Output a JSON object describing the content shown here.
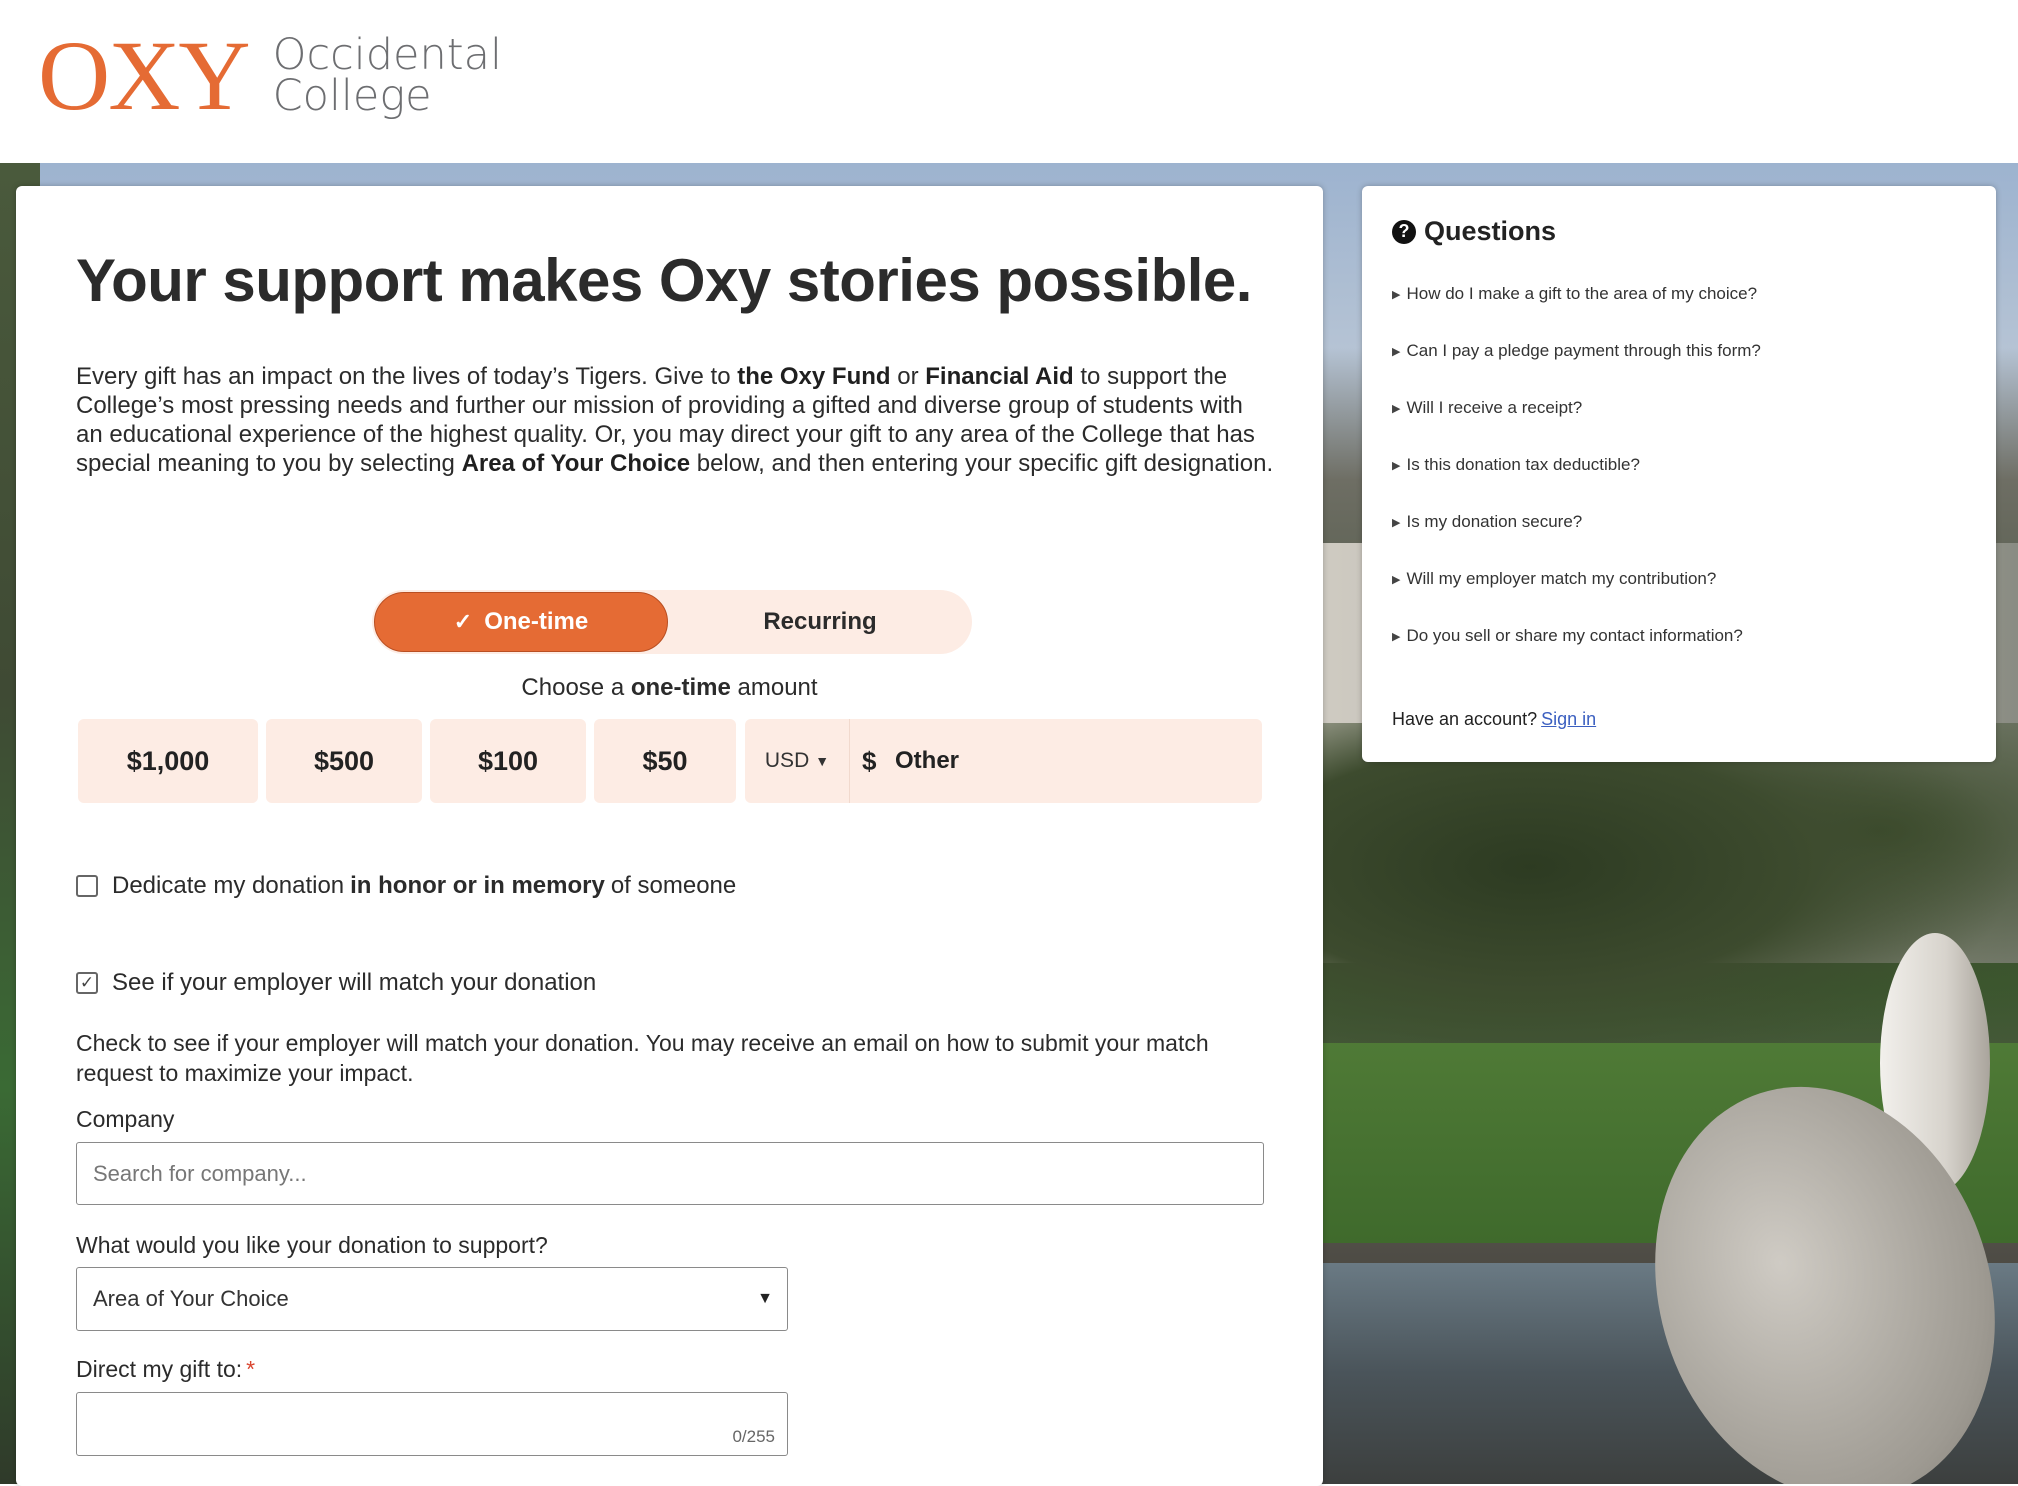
{
  "brand": {
    "mark": "OXY",
    "name_line1": "Occidental",
    "name_line2": "College",
    "accent_color": "#e56b34"
  },
  "main": {
    "headline": "Your support makes Oxy stories possible.",
    "intro": {
      "p1": "Every gift has an impact on the lives of today’s Tigers. Give to ",
      "b1": "the Oxy Fund",
      "p2": " or ",
      "b2": "Financial Aid",
      "p3": " to support the College’s most pressing needs and further our mission of providing a gifted and diverse group of students with an educational experience of the highest quality. Or, you may direct your gift to any area of the College that has special meaning to you by selecting ",
      "b3": "Area of Your Choice",
      "p4": " below, and then entering your specific gift designation."
    },
    "frequency": {
      "one_time": "One-time",
      "recurring": "Recurring",
      "selected_check": "✓"
    },
    "choose": {
      "prefix": "Choose a ",
      "bold": "one-time",
      "suffix": " amount"
    },
    "amounts": [
      "$1,000",
      "$500",
      "$100",
      "$50"
    ],
    "currency": "USD",
    "other": {
      "symbol": "$",
      "label": "Other"
    },
    "dedicate": {
      "prefix": "Dedicate my donation",
      "bold": "in honor or in memory",
      "suffix": "of someone",
      "checked": false
    },
    "employer_match": {
      "label": "See if your employer will match your donation",
      "checked": true,
      "check_glyph": "✓",
      "description": "Check to see if your employer will match your donation. You may receive an email on how to submit your match request to maximize your impact."
    },
    "company": {
      "label": "Company",
      "placeholder": "Search for company..."
    },
    "support": {
      "label": "What would you like your donation to support?",
      "selected": "Area of Your Choice"
    },
    "direct": {
      "label": "Direct my gift to:",
      "required_mark": "*",
      "counter": "0/255"
    }
  },
  "questions": {
    "title": "Questions",
    "icon": "question-circle-icon",
    "items": [
      "How do I make a gift to the area of my choice?",
      "Can I pay a pledge payment through this form?",
      "Will I receive a receipt?",
      "Is this donation tax deductible?",
      "Is my donation secure?",
      "Will my employer match my contribution?",
      "Do you sell or share my contact information?"
    ],
    "account_prompt": "Have an account?",
    "sign_in": "Sign in"
  }
}
